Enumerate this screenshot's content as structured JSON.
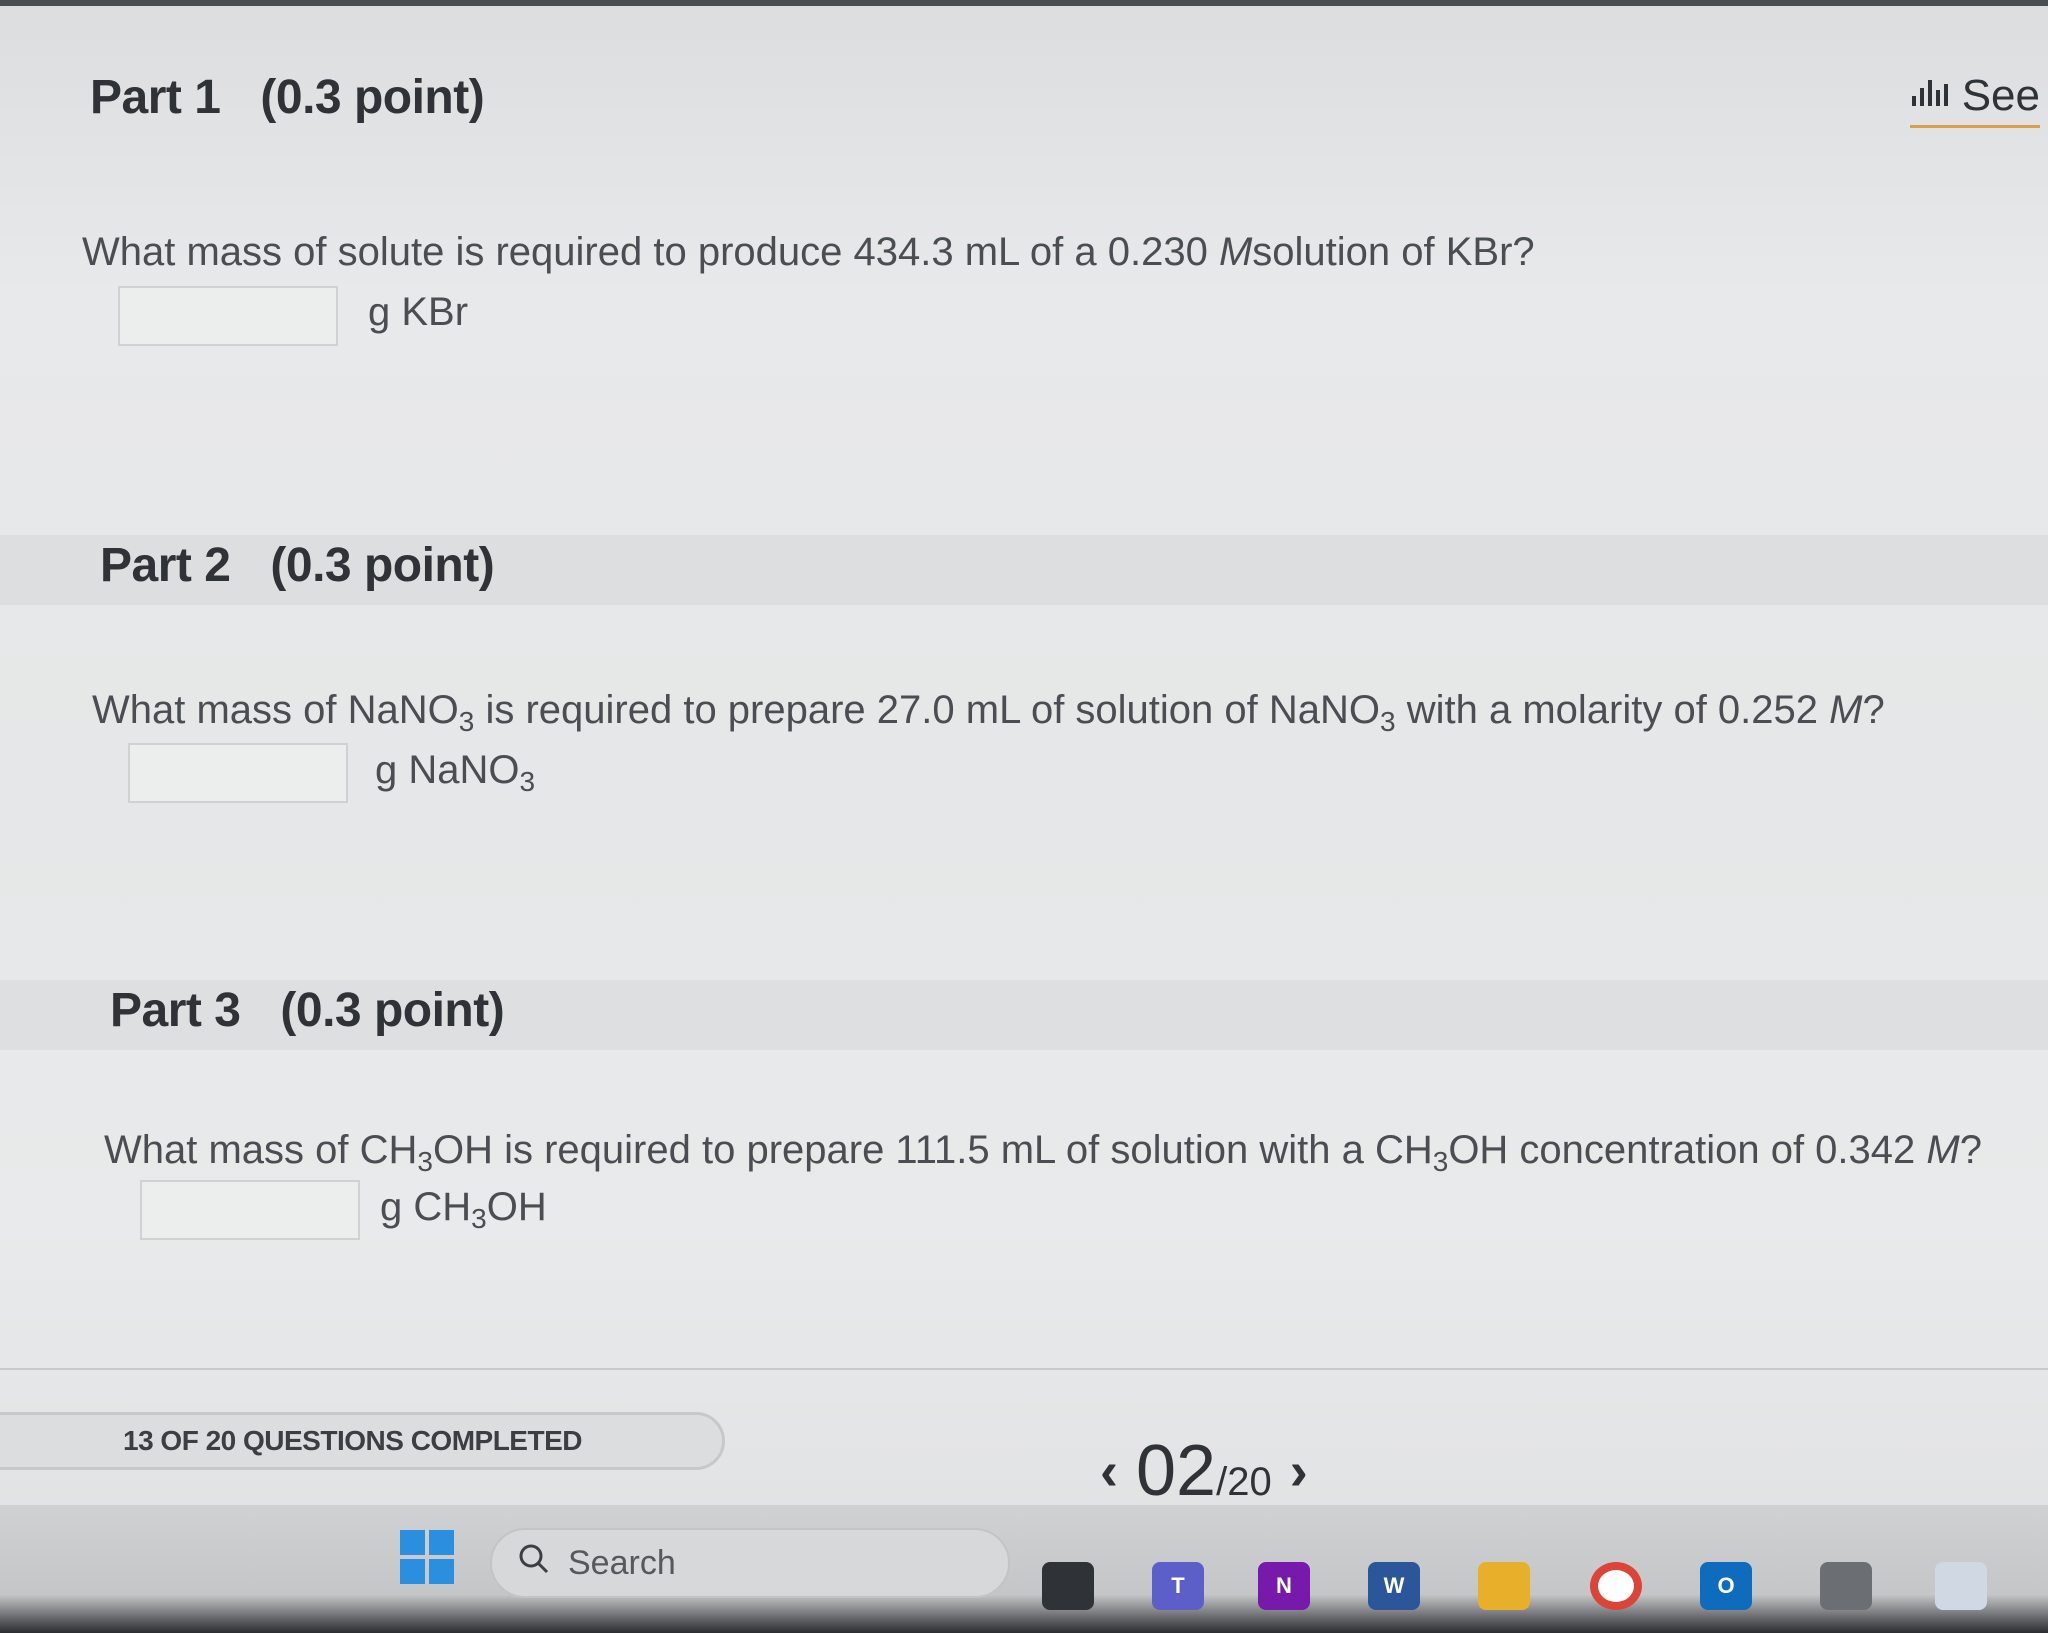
{
  "see_link": {
    "label": "See"
  },
  "parts": [
    {
      "title": "Part 1",
      "points": "(0.3 point)",
      "question_pre": "What mass of solute is required to produce 434.3 mL of a 0.230 ",
      "question_unit": "M",
      "question_post": "solution of KBr?",
      "answer_value": "",
      "unit_prefix": "g KBr",
      "unit_sub": "",
      "unit_suffix": ""
    },
    {
      "title": "Part 2",
      "points": "(0.3 point)",
      "q_a": "What mass of NaNO",
      "q_a_sub": "3",
      "q_b": " is required to prepare 27.0 mL of solution of NaNO",
      "q_b_sub": "3",
      "q_c": " with a molarity of 0.252 ",
      "q_unit": "M",
      "q_end": "?",
      "answer_value": "",
      "unit_prefix": "g NaNO",
      "unit_sub": "3",
      "unit_suffix": ""
    },
    {
      "title": "Part 3",
      "points": "(0.3 point)",
      "q_a": "What mass of CH",
      "q_a_sub": "3",
      "q_b": "OH is required to prepare 111.5 mL of solution with a CH",
      "q_b_sub": "3",
      "q_c": "OH concentration of 0.342 ",
      "q_unit": "M",
      "q_end": "?",
      "answer_value": "",
      "unit_prefix": "g CH",
      "unit_sub": "3",
      "unit_suffix": "OH"
    }
  ],
  "footer": {
    "progress_text": "13 OF 20 QUESTIONS COMPLETED",
    "current_page": "02",
    "total_pages": "/20",
    "prev_icon": "chevron-left-icon",
    "next_icon": "chevron-right-icon"
  },
  "taskbar": {
    "search_placeholder": "Search",
    "apps": [
      "windows-start-icon",
      "search-icon",
      "file-explorer-icon",
      "teams-icon",
      "onenote-icon",
      "word-icon",
      "folder-icon",
      "chrome-icon",
      "outlook-icon",
      "calculator-icon",
      "notepad-icon"
    ]
  },
  "colors": {
    "accent_underline": "#d9a04a",
    "windows_blue": "#2b8fe0"
  }
}
